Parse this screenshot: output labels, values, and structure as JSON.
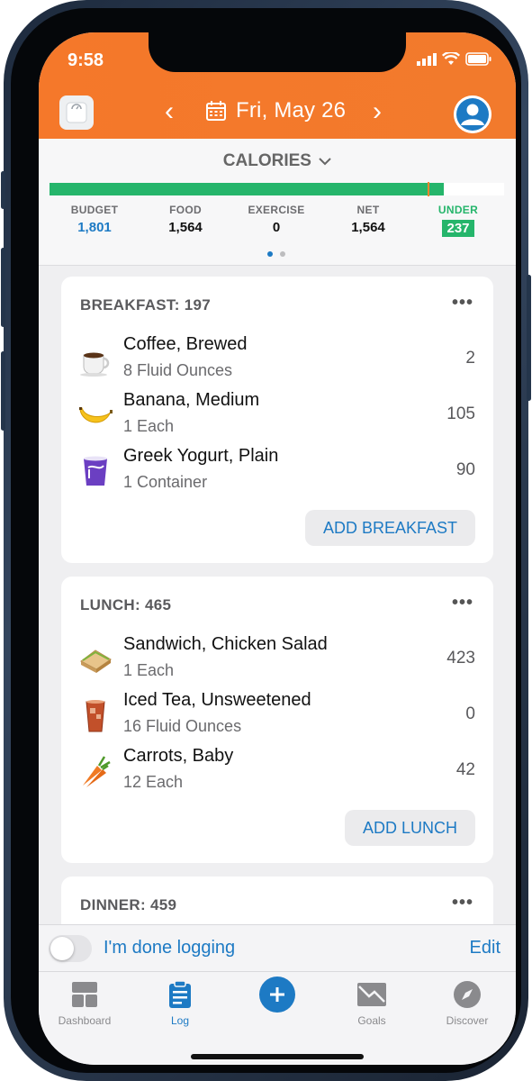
{
  "status": {
    "time": "9:58"
  },
  "header": {
    "date": "Fri, May 26",
    "prev": "‹",
    "next": "›"
  },
  "summary": {
    "title": "CALORIES",
    "budget_label": "BUDGET",
    "budget": "1,801",
    "food_label": "FOOD",
    "food": "1,564",
    "exercise_label": "EXERCISE",
    "exercise": "0",
    "net_label": "NET",
    "net": "1,564",
    "under_label": "UNDER",
    "under": "237",
    "progress_fraction": 0.868
  },
  "meals": [
    {
      "title": "BREAKFAST: 197",
      "more": "•••",
      "add_label": "ADD BREAKFAST",
      "items": [
        {
          "name": "Coffee, Brewed",
          "serving": "8 Fluid Ounces",
          "calories": "2",
          "icon": "coffee-icon"
        },
        {
          "name": "Banana, Medium",
          "serving": "1 Each",
          "calories": "105",
          "icon": "banana-icon"
        },
        {
          "name": "Greek Yogurt, Plain",
          "serving": "1 Container",
          "calories": "90",
          "icon": "yogurt-icon"
        }
      ]
    },
    {
      "title": "LUNCH: 465",
      "more": "•••",
      "add_label": "ADD LUNCH",
      "items": [
        {
          "name": "Sandwich, Chicken Salad",
          "serving": "1 Each",
          "calories": "423",
          "icon": "sandwich-icon"
        },
        {
          "name": "Iced Tea, Unsweetened",
          "serving": "16 Fluid Ounces",
          "calories": "0",
          "icon": "iced-tea-icon"
        },
        {
          "name": "Carrots, Baby",
          "serving": "12 Each",
          "calories": "42",
          "icon": "carrot-icon"
        }
      ]
    },
    {
      "title": "DINNER: 459",
      "more": "•••"
    }
  ],
  "done_bar": {
    "label": "I'm done logging",
    "edit": "Edit"
  },
  "tabs": {
    "dashboard": "Dashboard",
    "log": "Log",
    "goals": "Goals",
    "discover": "Discover"
  },
  "colors": {
    "accent": "#f5782a",
    "blue": "#1d7ac4",
    "green": "#25b56b"
  }
}
